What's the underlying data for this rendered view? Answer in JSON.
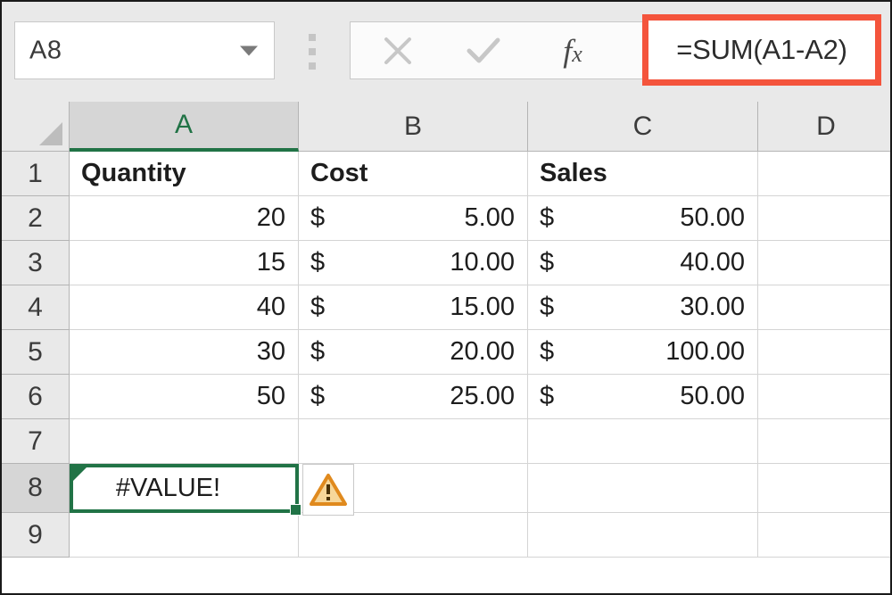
{
  "app": {
    "name": "excel-spreadsheet"
  },
  "namebox": {
    "value": "A8",
    "placeholder": "Name Box",
    "dropdown_icon": "chevron-down-icon"
  },
  "formula_bar": {
    "cancel_label": "cancel-icon",
    "enter_label": "checkmark-icon",
    "fx_label": "fx",
    "fx_main": "f",
    "fx_sub": "x",
    "value": "=SUM(A1-A2)",
    "highlight_color": "#f4543c"
  },
  "grid": {
    "columns": [
      {
        "label": "A",
        "active": true
      },
      {
        "label": "B",
        "active": false
      },
      {
        "label": "C",
        "active": false
      },
      {
        "label": "D",
        "active": false
      }
    ],
    "rows": [
      {
        "label": "1",
        "active": false
      },
      {
        "label": "2",
        "active": false
      },
      {
        "label": "3",
        "active": false
      },
      {
        "label": "4",
        "active": false
      },
      {
        "label": "5",
        "active": false
      },
      {
        "label": "6",
        "active": false
      },
      {
        "label": "7",
        "active": false
      },
      {
        "label": "8",
        "active": true
      },
      {
        "label": "9",
        "active": false
      }
    ],
    "cells": {
      "A1": "Quantity",
      "B1": "Cost",
      "C1": "Sales",
      "A2": "20",
      "A3": "15",
      "A4": "40",
      "A5": "30",
      "A6": "50",
      "B2_sym": "$",
      "B2_val": "5.00",
      "B3_sym": "$",
      "B3_val": "10.00",
      "B4_sym": "$",
      "B4_val": "15.00",
      "B5_sym": "$",
      "B5_val": "20.00",
      "B6_sym": "$",
      "B6_val": "25.00",
      "C2_sym": "$",
      "C2_val": "50.00",
      "C3_sym": "$",
      "C3_val": "40.00",
      "C4_sym": "$",
      "C4_val": "30.00",
      "C5_sym": "$",
      "C5_val": "100.00",
      "C6_sym": "$",
      "C6_val": "50.00",
      "A8": "#VALUE!"
    },
    "selection": {
      "address": "A8",
      "border_color": "#217346",
      "error_flag_icon": "error-triangle-indicator"
    },
    "warning": {
      "icon": "warning-triangle-icon",
      "fill_color": "#f5d08a",
      "stroke_color": "#e08a1e"
    }
  }
}
